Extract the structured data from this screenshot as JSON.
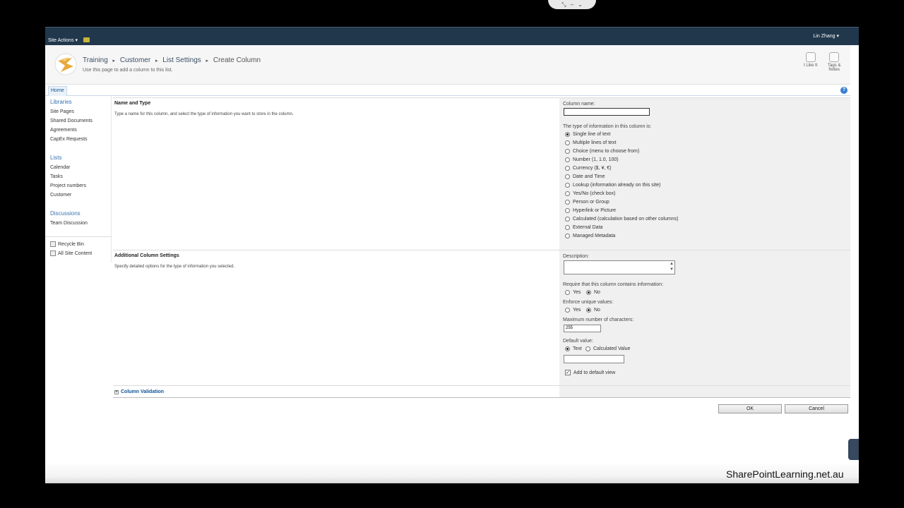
{
  "ribbon": {
    "site_actions": "Site Actions ▾",
    "user": "Lin Zhang ▾"
  },
  "breadcrumb": {
    "items": [
      "Training",
      "Customer",
      "List Settings",
      "Create Column"
    ],
    "sep": "▸",
    "subtitle": "Use this page to add a column to this list."
  },
  "social": {
    "like": "I Like It",
    "tags_line1": "Tags &",
    "tags_line2": "Notes"
  },
  "topnav": {
    "home": "Home",
    "help": "?"
  },
  "quicklaunch": {
    "libraries_head": "Libraries",
    "libraries": [
      "Site Pages",
      "Shared Documents",
      "Agreements",
      "CapEx Requests"
    ],
    "lists_head": "Lists",
    "lists": [
      "Calendar",
      "Tasks",
      "Project numbers",
      "Customer"
    ],
    "discussions_head": "Discussions",
    "discussions": [
      "Team Discussion"
    ],
    "recycle_bin": "Recycle Bin",
    "all_site_content": "All Site Content"
  },
  "name_type": {
    "title": "Name and Type",
    "desc": "Type a name for this column, and select the type of information you want to store in the column.",
    "column_name_label": "Column name:",
    "column_name_value": "",
    "type_label": "The type of information in this column is:",
    "types": [
      "Single line of text",
      "Multiple lines of text",
      "Choice (menu to choose from)",
      "Number (1, 1.0, 100)",
      "Currency ($, ¥, €)",
      "Date and Time",
      "Lookup (information already on this site)",
      "Yes/No (check box)",
      "Person or Group",
      "Hyperlink or Picture",
      "Calculated (calculation based on other columns)",
      "External Data",
      "Managed Metadata"
    ],
    "selected_type": "Single line of text"
  },
  "additional": {
    "title": "Additional Column Settings",
    "desc": "Specify detailed options for the type of information you selected.",
    "description_label": "Description:",
    "require_label": "Require that this column contains information:",
    "enforce_label": "Enforce unique values:",
    "yes": "Yes",
    "no": "No",
    "max_chars_label": "Maximum number of characters:",
    "max_chars_value": "255",
    "default_label": "Default value:",
    "default_text": "Text",
    "default_calc": "Calculated Value",
    "add_default_view": "Add to default view"
  },
  "validation": {
    "label": "Column Validation",
    "expander": "+"
  },
  "buttons": {
    "ok": "OK",
    "cancel": "Cancel"
  },
  "watermark": "SharePointLearning.net.au",
  "colors": {
    "ribbon": "#21374c",
    "link": "#3b73af",
    "panel": "#f0f0f0"
  }
}
